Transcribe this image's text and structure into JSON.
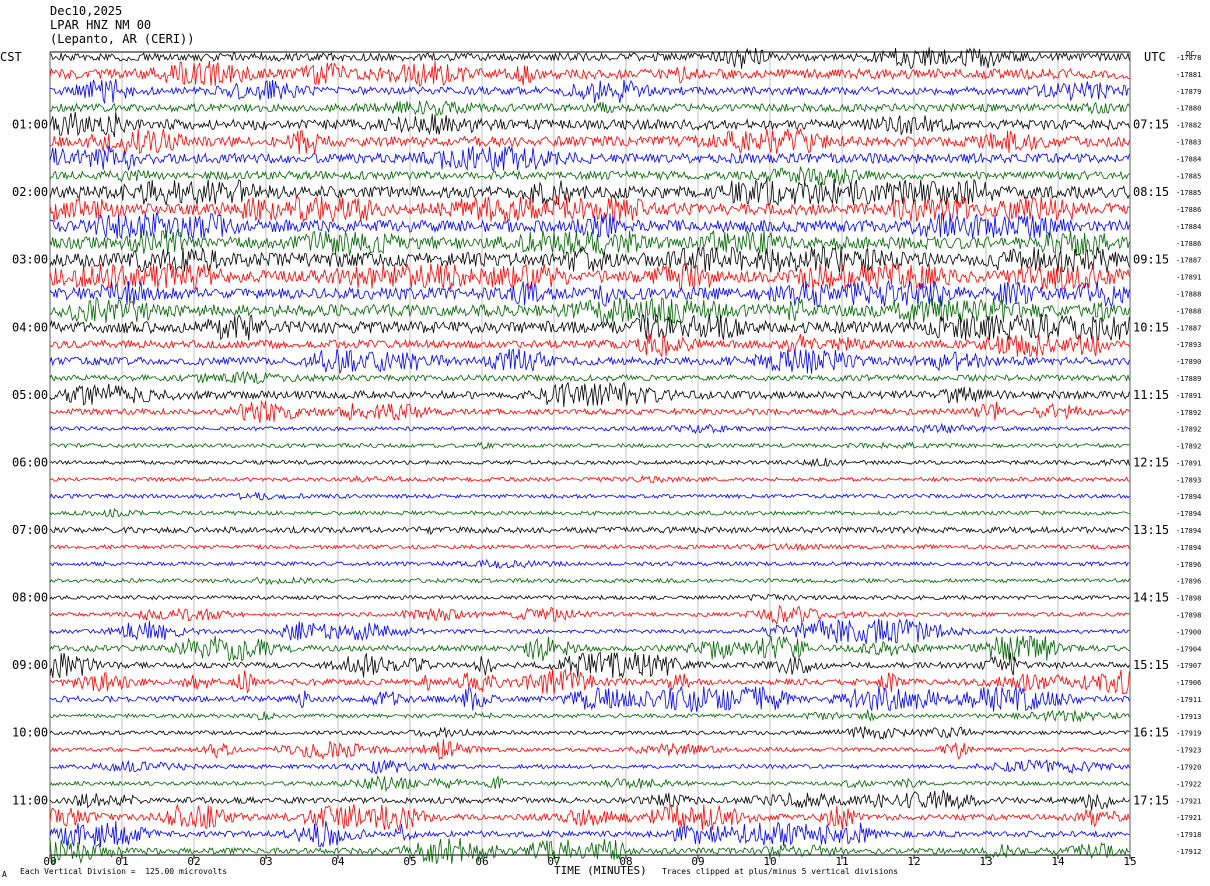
{
  "header": {
    "date": "Dec10,2025",
    "station": "LPAR HNZ NM 00",
    "location": "(Lepanto, AR (CERI))"
  },
  "tz_left": "CST",
  "tz_right": "UTC",
  "right_header": "DC",
  "footer": {
    "corner": "A",
    "scale": "Each Vertical Division =  125.00 microvolts",
    "xlabel": "TIME (MINUTES)",
    "clip": "Traces clipped at plus/minus 5 vertical divisions"
  },
  "colors": [
    "#000000",
    "#ff0000",
    "#0000ff",
    "#006400"
  ],
  "chart_data": {
    "type": "line",
    "x_ticks": [
      "00",
      "01",
      "02",
      "03",
      "04",
      "05",
      "06",
      "07",
      "08",
      "09",
      "10",
      "11",
      "12",
      "13",
      "14",
      "15"
    ],
    "xlim": [
      0,
      15
    ],
    "left_hour_labels": [
      "01:00",
      "02:00",
      "03:00",
      "04:00",
      "05:00",
      "06:00",
      "07:00",
      "08:00",
      "09:00",
      "10:00",
      "11:00"
    ],
    "right_hour_labels": [
      "07:15",
      "08:15",
      "09:15",
      "10:15",
      "11:15",
      "12:15",
      "13:15",
      "14:15",
      "15:15",
      "16:15",
      "17:15"
    ],
    "trace_dc_offsets": [
      "-17878",
      "-17881",
      "-17879",
      "-17880",
      "-17882",
      "-17883",
      "-17884",
      "-17885",
      "-17885",
      "-17886",
      "-17884",
      "-17886",
      "-17887",
      "-17891",
      "-17888",
      "-17888",
      "-17887",
      "-17893",
      "-17890",
      "-17889",
      "-17891",
      "-17892",
      "-17892",
      "-17892",
      "-17891",
      "-17893",
      "-17894",
      "-17894",
      "-17894",
      "-17894",
      "-17896",
      "-17896",
      "-17898",
      "-17898",
      "-17900",
      "-17904",
      "-17907",
      "-17906",
      "-17911",
      "-17913",
      "-17919",
      "-17923",
      "-17920",
      "-17922",
      "-17921",
      "-17921",
      "-17918",
      "-17912"
    ],
    "trace_amplitude": [
      4,
      5,
      4,
      4,
      5,
      5,
      5,
      4,
      6,
      6,
      6,
      6,
      7,
      6,
      6,
      6,
      6,
      4,
      4,
      3,
      4,
      3,
      2,
      2,
      2,
      2,
      2,
      2,
      3,
      2,
      2,
      2,
      2,
      2,
      2,
      3,
      3,
      3,
      3,
      2,
      2,
      2,
      2,
      2,
      3,
      3,
      3,
      3
    ],
    "trace_bursts": [
      [
        3,
        2
      ],
      [
        5,
        2
      ],
      [
        4,
        2
      ],
      [
        3,
        1
      ],
      [
        4,
        2
      ],
      [
        5,
        2
      ],
      [
        5,
        2
      ],
      [
        3,
        1
      ],
      [
        8,
        3
      ],
      [
        8,
        3
      ],
      [
        8,
        3
      ],
      [
        8,
        3
      ],
      [
        9,
        3
      ],
      [
        9,
        3
      ],
      [
        9,
        3
      ],
      [
        9,
        3
      ],
      [
        7,
        3
      ],
      [
        6,
        2
      ],
      [
        6,
        3
      ],
      [
        2,
        1
      ],
      [
        6,
        2
      ],
      [
        5,
        2
      ],
      [
        2,
        1
      ],
      [
        2,
        1
      ],
      [
        2,
        1
      ],
      [
        2,
        1
      ],
      [
        1,
        1
      ],
      [
        1,
        1
      ],
      [
        1,
        1
      ],
      [
        1,
        1
      ],
      [
        1,
        1
      ],
      [
        1,
        1
      ],
      [
        1,
        1
      ],
      [
        6,
        3
      ],
      [
        9,
        3
      ],
      [
        12,
        3
      ],
      [
        9,
        3
      ],
      [
        10,
        3
      ],
      [
        10,
        3
      ],
      [
        5,
        2
      ],
      [
        3,
        2
      ],
      [
        5,
        3
      ],
      [
        6,
        2
      ],
      [
        6,
        2
      ],
      [
        7,
        2
      ],
      [
        8,
        3
      ],
      [
        8,
        3
      ],
      [
        9,
        3
      ]
    ]
  }
}
